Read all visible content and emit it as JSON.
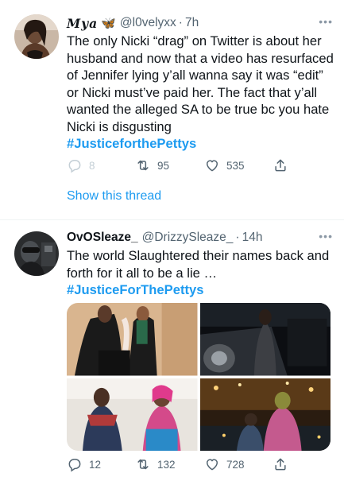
{
  "tweets": [
    {
      "display_name": "Mya",
      "verified_symbol": "🦋",
      "handle": "@l0velyxx",
      "time": "7h",
      "text": "The only Nicki “drag” on Twitter is about her husband and now that a video has resurfaced of Jennifer lying y’all wanna say it was “edit” or Nicki must’ve paid her. The fact that y’all wanted the alleged SA to be true bc you hate Nicki is disgusting",
      "hashtag": "#JusticefortheP​ettys",
      "replies": "8",
      "retweets": "95",
      "likes": "535",
      "show_thread": "Show this thread"
    },
    {
      "display_name": "OvOSleaze_",
      "handle": "@DrizzySleaze_",
      "time": "14h",
      "text": "The world Slaughtered their names back and forth for it all to be a lie …",
      "hashtag": "#JusticeForThePettys",
      "replies": "12",
      "retweets": "132",
      "likes": "728"
    }
  ],
  "icons": {
    "reply": "reply-icon",
    "retweet": "retweet-icon",
    "like": "heart-icon",
    "share": "share-icon",
    "more": "more-icon"
  },
  "colors": {
    "link": "#1d9bf0",
    "muted": "#536471",
    "text": "#0f1419"
  }
}
